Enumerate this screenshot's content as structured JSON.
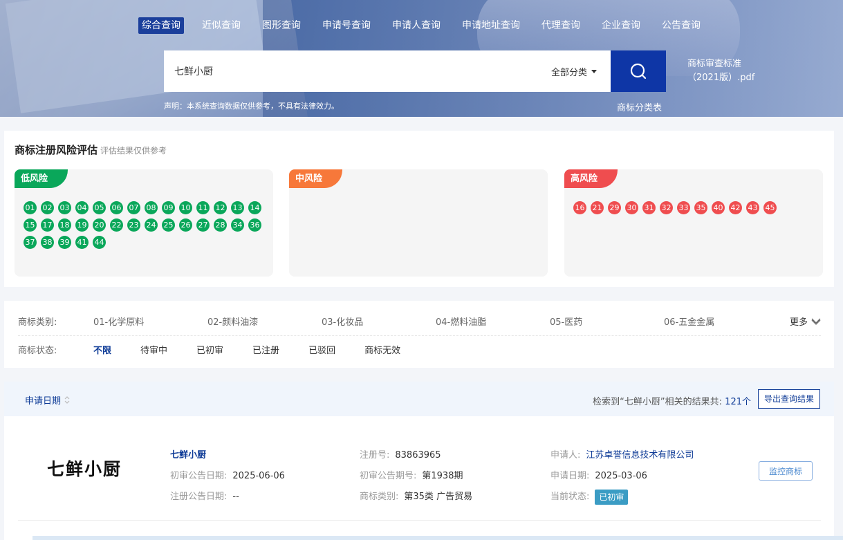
{
  "nav": {
    "items": [
      "综合查询",
      "近似查询",
      "图形查询",
      "申请号查询",
      "申请人查询",
      "申请地址查询",
      "代理查询",
      "企业查询",
      "公告查询"
    ]
  },
  "search": {
    "value": "七鲜小厨",
    "category": "全部分类",
    "disclaimer": "声明：本系统查询数据仅供参考，不具有法律效力。",
    "pdf_line1": "商标审查标准",
    "pdf_line2": "（2021版）.pdf",
    "class_table": "商标分类表"
  },
  "risk": {
    "title": "商标注册风险评估",
    "subtitle": "评估结果仅供参考",
    "low_label": "低风险",
    "mid_label": "中风险",
    "high_label": "高风险",
    "low": [
      "01",
      "02",
      "03",
      "04",
      "05",
      "06",
      "07",
      "08",
      "09",
      "10",
      "11",
      "12",
      "13",
      "14",
      "15",
      "17",
      "18",
      "19",
      "20",
      "22",
      "23",
      "24",
      "25",
      "26",
      "27",
      "28",
      "34",
      "36",
      "37",
      "38",
      "39",
      "41",
      "44"
    ],
    "mid": [],
    "high": [
      "16",
      "21",
      "29",
      "30",
      "31",
      "32",
      "33",
      "35",
      "40",
      "42",
      "43",
      "45"
    ]
  },
  "filters": {
    "category_label": "商标类别:",
    "categories": [
      "01-化学原料",
      "02-颜料油漆",
      "03-化妆品",
      "04-燃料油脂",
      "05-医药",
      "06-五金金属"
    ],
    "more": "更多",
    "status_label": "商标状态:",
    "statuses": [
      "不限",
      "待审中",
      "已初审",
      "已注册",
      "已驳回",
      "商标无效"
    ]
  },
  "results": {
    "sort_label": "申请日期",
    "count_prefix": "检索到“七鲜小厨”相关的结果共:",
    "count": "121个",
    "export": "导出查询结果"
  },
  "item": {
    "logo": "七鲜小厨",
    "name": "七鲜小厨",
    "prelim_date_label": "初审公告日期:",
    "prelim_date": "2025-06-06",
    "reg_date_label": "注册公告日期:",
    "reg_date": "--",
    "reg_no_label": "注册号:",
    "reg_no": "83863965",
    "issue_label": "初审公告期号:",
    "issue": "第1938期",
    "class_label": "商标类别:",
    "class": "第35类 广告贸易",
    "applicant_label": "申请人:",
    "applicant": "江苏卓誉信息技术有限公司",
    "apply_date_label": "申请日期:",
    "apply_date": "2025-03-06",
    "status_label": "当前状态:",
    "status": "已初审",
    "monitor": "监控商标"
  },
  "colors": {
    "primary": "#0e36a6",
    "low": "#0aa75a",
    "mid": "#f7783a",
    "high": "#ef4d4f",
    "status": "#3b9cc4"
  }
}
